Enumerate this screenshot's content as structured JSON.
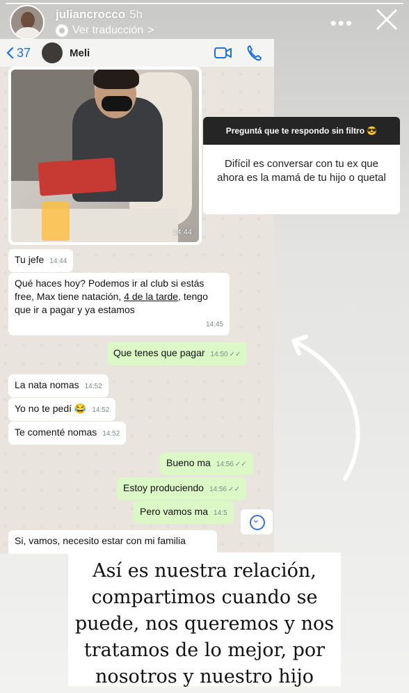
{
  "story": {
    "username": "juliancrocco",
    "time": "5h",
    "translate_label": "Ver traducción",
    "translate_chevron": ">",
    "more_label": "•••"
  },
  "chat": {
    "back_count": "37",
    "contact_name": "Meli",
    "photo_time": "14:44",
    "messages": [
      {
        "dir": "in",
        "text": "Tu jefe",
        "time": "14:44"
      },
      {
        "dir": "in",
        "text_a": "Qué haces hoy? Podemos ir al club si estás free, Max tiene natación, ",
        "text_link": "4 de la tarde",
        "text_b": ", tengo que ir a pagar y ya estamos",
        "time": "14:45"
      },
      {
        "dir": "out",
        "text": "Que tenes que pagar",
        "time": "14:50"
      },
      {
        "dir": "in",
        "text": "La nata nomas",
        "time": "14:52"
      },
      {
        "dir": "in",
        "text": "Yo no te pedí 😂",
        "time": "14:52"
      },
      {
        "dir": "in",
        "text": "Te comenté nomas",
        "time": "14:52"
      },
      {
        "dir": "out",
        "text": "Bueno ma",
        "time": "14:56"
      },
      {
        "dir": "out",
        "text": "Estoy produciendo",
        "time": "14:56"
      },
      {
        "dir": "out",
        "text": "Pero vamos ma",
        "time": "14:5"
      },
      {
        "dir": "in",
        "text": "Si, vamos, necesito estar con mi familia",
        "time": ""
      }
    ]
  },
  "question": {
    "title": "Preguntá que te respondo sin filtro 😎",
    "answer": "Difícil es conversar con tu ex que ahora es la mamá de tu hijo o quetal"
  },
  "caption": {
    "lines": [
      "Así es nuestra relación,",
      "compartimos cuando se",
      "puede, nos queremos y nos",
      "tratamos de lo mejor, por",
      "nosotros y nuestro hijo"
    ]
  },
  "colors": {
    "wa_link_blue": "#1f6fe4",
    "bubble_out": "#dcf8c6",
    "bubble_in": "#ffffff",
    "chat_bg": "#e9e4de"
  },
  "icons": [
    "translate-icon",
    "more-icon",
    "close-icon",
    "back-chevron-icon",
    "video-call-icon",
    "phone-call-icon",
    "forward-icon",
    "scroll-down-icon",
    "read-ticks-icon"
  ]
}
